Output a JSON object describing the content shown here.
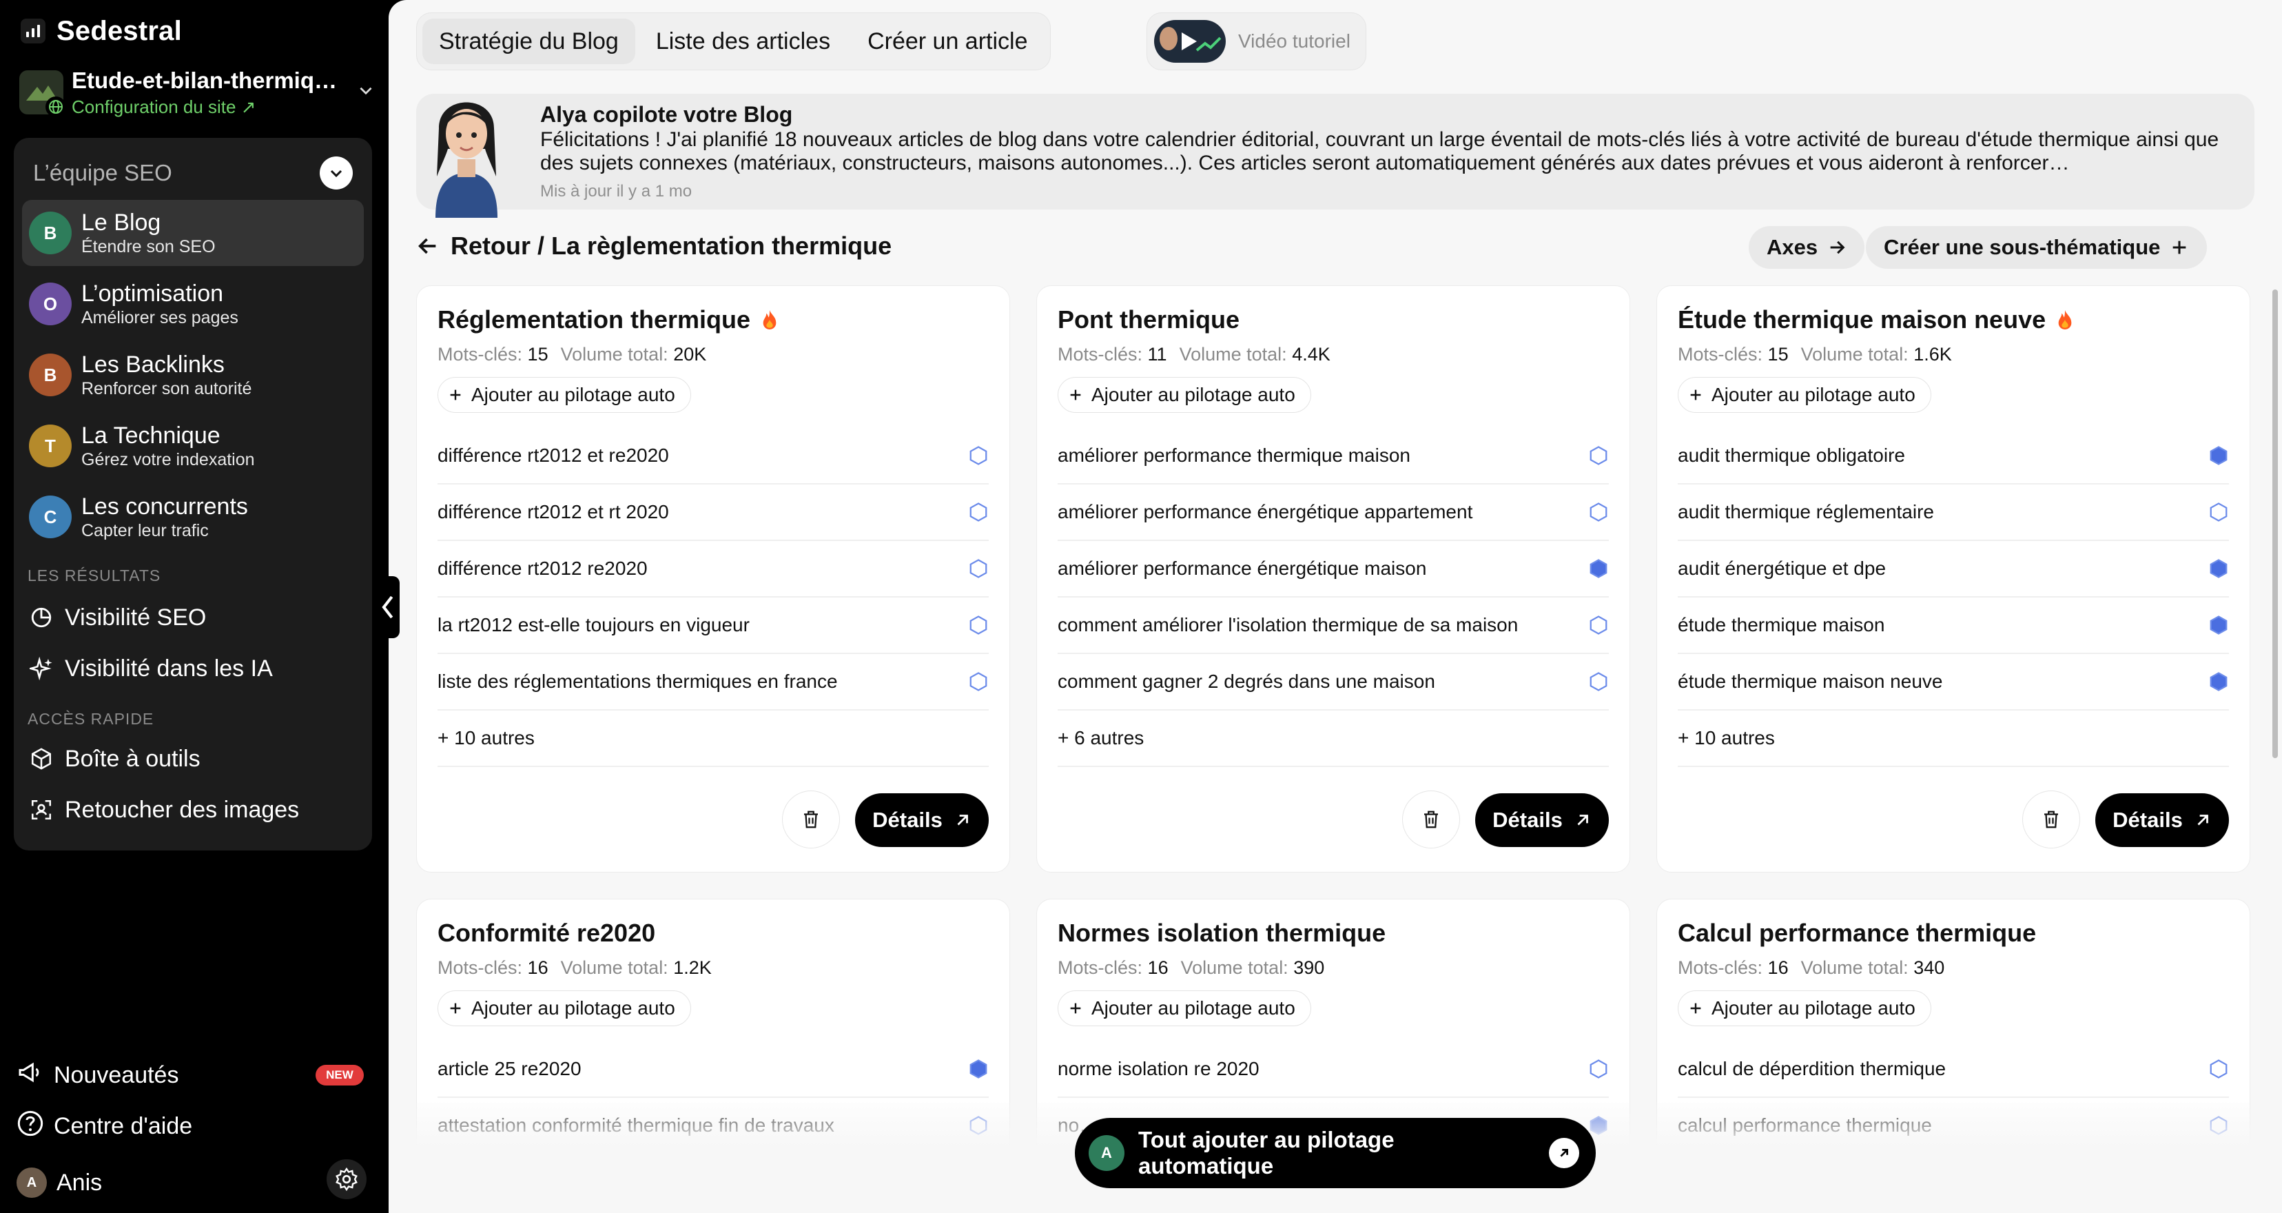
{
  "sidebar": {
    "brand": "Sedestral",
    "site": {
      "name": "Etude-et-bilan-thermiq…",
      "config": "Configuration du site"
    },
    "team_title": "L’équipe SEO",
    "team": [
      {
        "title": "Le Blog",
        "sub": "Étendre son SEO",
        "initials": "B",
        "color": "#2e7d5b"
      },
      {
        "title": "L’optimisation",
        "sub": "Améliorer ses pages",
        "initials": "O",
        "color": "#6b4fa0"
      },
      {
        "title": "Les Backlinks",
        "sub": "Renforcer son autorité",
        "initials": "B",
        "color": "#a8552d"
      },
      {
        "title": "La Technique",
        "sub": "Gérez votre indexation",
        "initials": "T",
        "color": "#b58a2b"
      },
      {
        "title": "Les concurrents",
        "sub": "Capter leur trafic",
        "initials": "C",
        "color": "#3c7fb5"
      }
    ],
    "results_label": "LES RÉSULTATS",
    "results": [
      "Visibilité SEO",
      "Visibilité dans les IA"
    ],
    "quick_label": "ACCÈS RAPIDE",
    "quick": [
      "Boîte à outils",
      "Retoucher des images"
    ],
    "footer": {
      "news": "Nouveautés",
      "new_badge": "NEW",
      "help": "Centre d'aide",
      "user": "Anis"
    }
  },
  "tabs": [
    "Stratégie du Blog",
    "Liste des articles",
    "Créer un article"
  ],
  "video_label": "Vidéo tutoriel",
  "alya": {
    "title": "Alya copilote votre Blog",
    "message": "Félicitations ! J'ai planifié 18 nouveaux articles de blog dans votre calendrier éditorial, couvrant un large éventail de mots-clés liés à votre activité de bureau d'étude thermique ainsi que des sujets connexes (matériaux, constructeurs, maisons autonomes...). Ces articles seront automatiquement générés aux dates prévues et vous aideront à renforcer…",
    "updated": "Mis à jour il y a 1 mo"
  },
  "breadcrumb": "Retour / La règlementation thermique",
  "actions": {
    "axes": "Axes",
    "create_sub": "Créer une sous-thématique"
  },
  "labels": {
    "keywords": "Mots-clés:",
    "volume": "Volume total:",
    "add_auto": "Ajouter au pilotage auto",
    "details": "Détails"
  },
  "cards": [
    {
      "title": "Réglementation thermique",
      "hot": true,
      "keywords": "15",
      "volume": "20K",
      "items": [
        {
          "text": "différence rt2012 et re2020",
          "filled": false
        },
        {
          "text": "différence rt2012 et rt 2020",
          "filled": false
        },
        {
          "text": "différence rt2012 re2020",
          "filled": false
        },
        {
          "text": "la rt2012 est-elle toujours en vigueur",
          "filled": false
        },
        {
          "text": "liste des réglementations thermiques en france",
          "filled": false
        }
      ],
      "more": "+ 10 autres"
    },
    {
      "title": "Pont thermique",
      "hot": false,
      "keywords": "11",
      "volume": "4.4K",
      "items": [
        {
          "text": "améliorer performance thermique maison",
          "filled": false
        },
        {
          "text": "améliorer performance énergétique appartement",
          "filled": false
        },
        {
          "text": "améliorer performance énergétique maison",
          "filled": true
        },
        {
          "text": "comment améliorer l'isolation thermique de sa maison",
          "filled": false
        },
        {
          "text": "comment gagner 2 degrés dans une maison",
          "filled": false
        }
      ],
      "more": "+ 6 autres"
    },
    {
      "title": "Étude thermique maison neuve",
      "hot": true,
      "keywords": "15",
      "volume": "1.6K",
      "items": [
        {
          "text": "audit thermique obligatoire",
          "filled": true
        },
        {
          "text": "audit thermique réglementaire",
          "filled": false
        },
        {
          "text": "audit énergétique et dpe",
          "filled": true
        },
        {
          "text": "étude thermique maison",
          "filled": true
        },
        {
          "text": "étude thermique maison neuve",
          "filled": true
        }
      ],
      "more": "+ 10 autres"
    },
    {
      "title": "Conformité re2020",
      "hot": false,
      "keywords": "16",
      "volume": "1.2K",
      "items": [
        {
          "text": "article 25 re2020",
          "filled": true
        },
        {
          "text": "attestation conformité thermique fin de travaux",
          "filled": false
        }
      ],
      "more": ""
    },
    {
      "title": "Normes isolation thermique",
      "hot": false,
      "keywords": "16",
      "volume": "390",
      "items": [
        {
          "text": "norme isolation re 2020",
          "filled": false
        },
        {
          "text": "no…",
          "filled": true
        }
      ],
      "more": ""
    },
    {
      "title": "Calcul performance thermique",
      "hot": false,
      "keywords": "16",
      "volume": "340",
      "items": [
        {
          "text": "calcul de déperdition thermique",
          "filled": false
        },
        {
          "text": "calcul performance thermique",
          "filled": false
        }
      ],
      "more": ""
    }
  ],
  "cta": "Tout ajouter au pilotage automatique",
  "colors": {
    "hex_filled": "#4a6ee0",
    "hex_outline": "#6b8bea",
    "new_badge": "#e23b3b",
    "link_green": "#6fd06a"
  }
}
